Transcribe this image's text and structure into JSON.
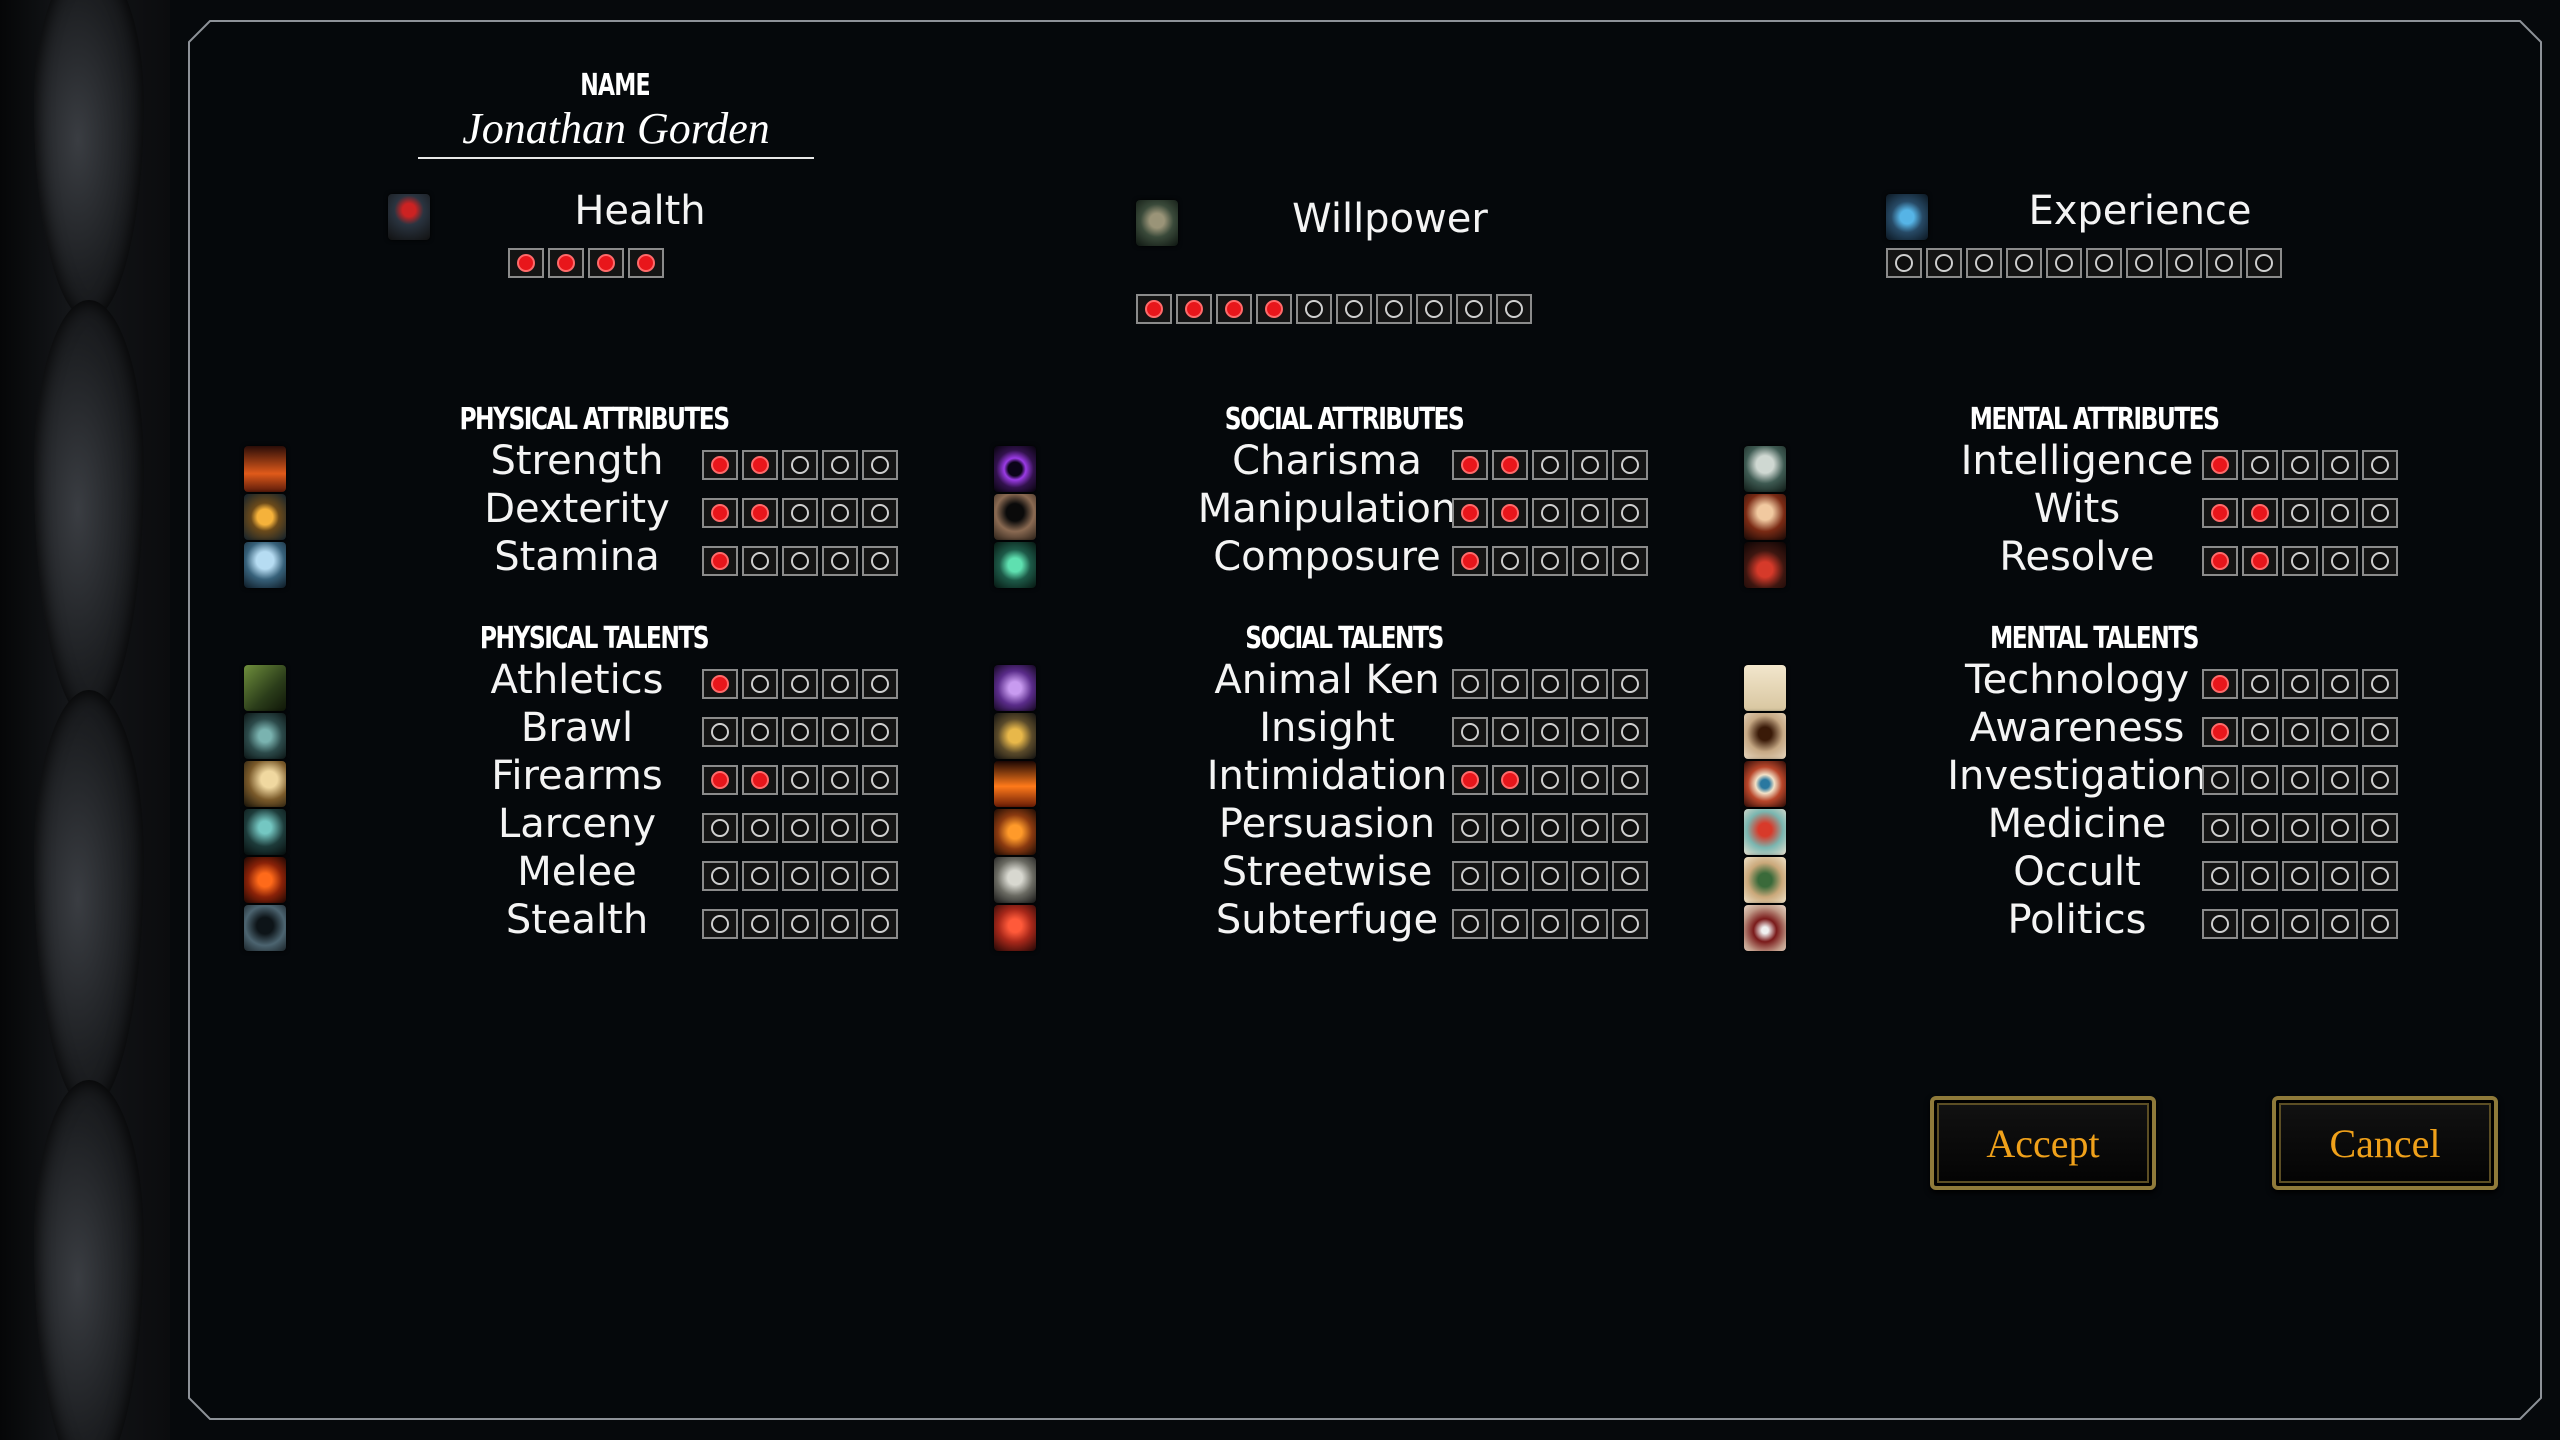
{
  "character": {
    "name_label": "NAME",
    "name": "Jonathan Gorden"
  },
  "stats": {
    "health": {
      "label": "Health",
      "icon": "bleeding-figure-icon",
      "filled": 4,
      "total": 4
    },
    "willpower": {
      "label": "Willpower",
      "icon": "hooded-figure-icon",
      "filled": 4,
      "total": 10
    },
    "experience": {
      "label": "Experience",
      "icon": "water-drop-icon",
      "filled": 0,
      "total": 10
    }
  },
  "sections": [
    {
      "title": "PHYSICAL ATTRIBUTES",
      "rows": [
        {
          "label": "Strength",
          "icon": "strength-icon",
          "filled": 2
        },
        {
          "label": "Dexterity",
          "icon": "dexterity-gear-icon",
          "filled": 2
        },
        {
          "label": "Stamina",
          "icon": "stamina-skull-icon",
          "filled": 1
        }
      ]
    },
    {
      "title": "SOCIAL ATTRIBUTES",
      "rows": [
        {
          "label": "Charisma",
          "icon": "charisma-orb-icon",
          "filled": 2
        },
        {
          "label": "Manipulation",
          "icon": "manipulation-hood-icon",
          "filled": 2
        },
        {
          "label": "Composure",
          "icon": "composure-wings-icon",
          "filled": 1
        }
      ]
    },
    {
      "title": "MENTAL ATTRIBUTES",
      "rows": [
        {
          "label": "Intelligence",
          "icon": "intelligence-head-icon",
          "filled": 1
        },
        {
          "label": "Wits",
          "icon": "wits-face-icon",
          "filled": 2
        },
        {
          "label": "Resolve",
          "icon": "resolve-figure-icon",
          "filled": 2
        }
      ]
    },
    {
      "title": "PHYSICAL TALENTS",
      "rows": [
        {
          "label": "Athletics",
          "icon": "athletics-icon",
          "filled": 1
        },
        {
          "label": "Brawl",
          "icon": "brawl-icon",
          "filled": 0
        },
        {
          "label": "Firearms",
          "icon": "firearms-icon",
          "filled": 2
        },
        {
          "label": "Larceny",
          "icon": "larceny-icon",
          "filled": 0
        },
        {
          "label": "Melee",
          "icon": "melee-icon",
          "filled": 0
        },
        {
          "label": "Stealth",
          "icon": "stealth-icon",
          "filled": 0
        }
      ]
    },
    {
      "title": "SOCIAL TALENTS",
      "rows": [
        {
          "label": "Animal Ken",
          "icon": "animal-ken-icon",
          "filled": 0
        },
        {
          "label": "Insight",
          "icon": "insight-icon",
          "filled": 0
        },
        {
          "label": "Intimidation",
          "icon": "intimidation-icon",
          "filled": 2
        },
        {
          "label": "Persuasion",
          "icon": "persuasion-icon",
          "filled": 0
        },
        {
          "label": "Streetwise",
          "icon": "streetwise-icon",
          "filled": 0
        },
        {
          "label": "Subterfuge",
          "icon": "subterfuge-icon",
          "filled": 0
        }
      ]
    },
    {
      "title": "MENTAL TALENTS",
      "rows": [
        {
          "label": "Technology",
          "icon": "technology-icon",
          "filled": 1
        },
        {
          "label": "Awareness",
          "icon": "awareness-icon",
          "filled": 1
        },
        {
          "label": "Investigation",
          "icon": "investigation-eye-icon",
          "filled": 0
        },
        {
          "label": "Medicine",
          "icon": "medicine-icon",
          "filled": 0
        },
        {
          "label": "Occult",
          "icon": "occult-hand-icon",
          "filled": 0
        },
        {
          "label": "Politics",
          "icon": "politics-icon",
          "filled": 0
        }
      ]
    }
  ],
  "buttons": {
    "accept": "Accept",
    "cancel": "Cancel"
  }
}
